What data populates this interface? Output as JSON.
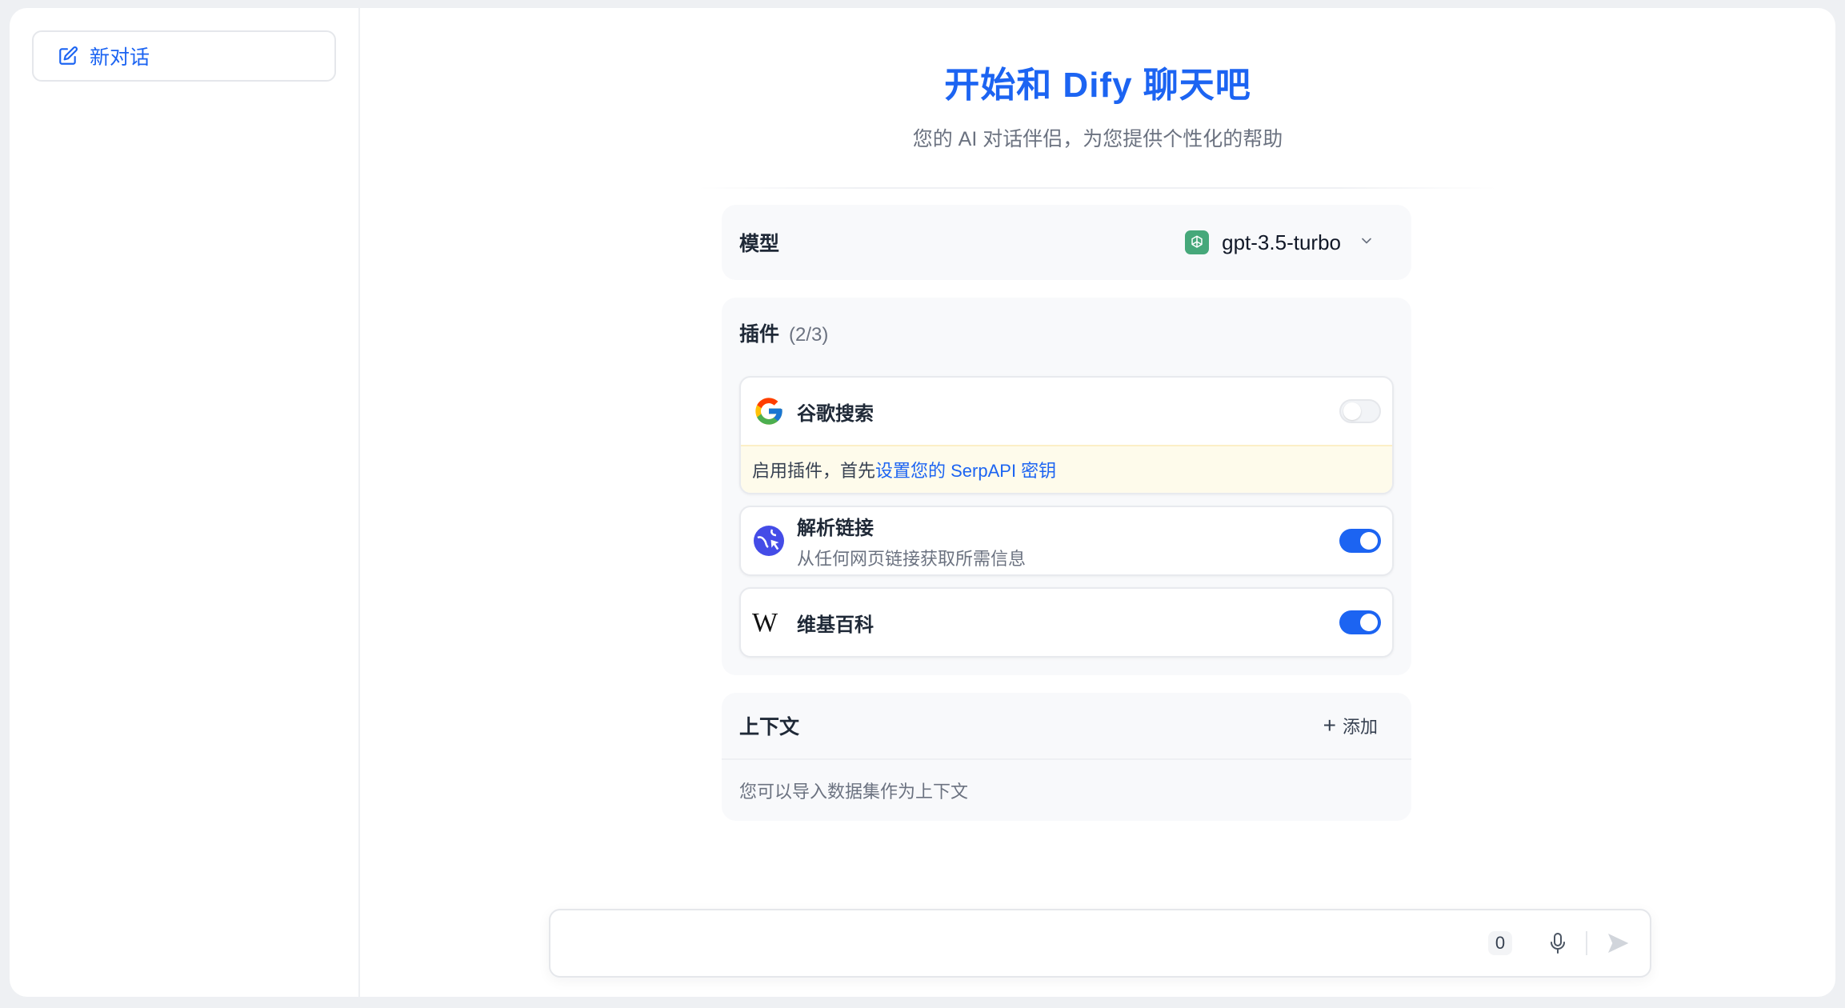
{
  "sidebar": {
    "new_chat_label": "新对话",
    "new_chat_icon": "edit-icon"
  },
  "hero": {
    "title": "开始和 Dify 聊天吧",
    "subtitle": "您的 AI 对话伴侣，为您提供个性化的帮助"
  },
  "model": {
    "label": "模型",
    "selected": "gpt-3.5-turbo",
    "icon": "openai-icon"
  },
  "plugins": {
    "label": "插件",
    "count": "(2/3)",
    "items": [
      {
        "name": "谷歌搜索",
        "icon": "google-icon",
        "enabled": false,
        "warning_prefix": "启用插件，首先",
        "warning_link": "设置您的 SerpAPI 密钥"
      },
      {
        "name": "解析链接",
        "description": "从任何网页链接获取所需信息",
        "icon": "web-reader-icon",
        "enabled": true
      },
      {
        "name": "维基百科",
        "icon": "wikipedia-icon",
        "enabled": true
      }
    ]
  },
  "context": {
    "label": "上下文",
    "add_label": "添加",
    "hint": "您可以导入数据集作为上下文"
  },
  "input": {
    "placeholder": "",
    "char_count": "0"
  },
  "colors": {
    "accent": "#1c64f2",
    "openai": "#46a87a",
    "warning_bg": "#fefbeb"
  }
}
